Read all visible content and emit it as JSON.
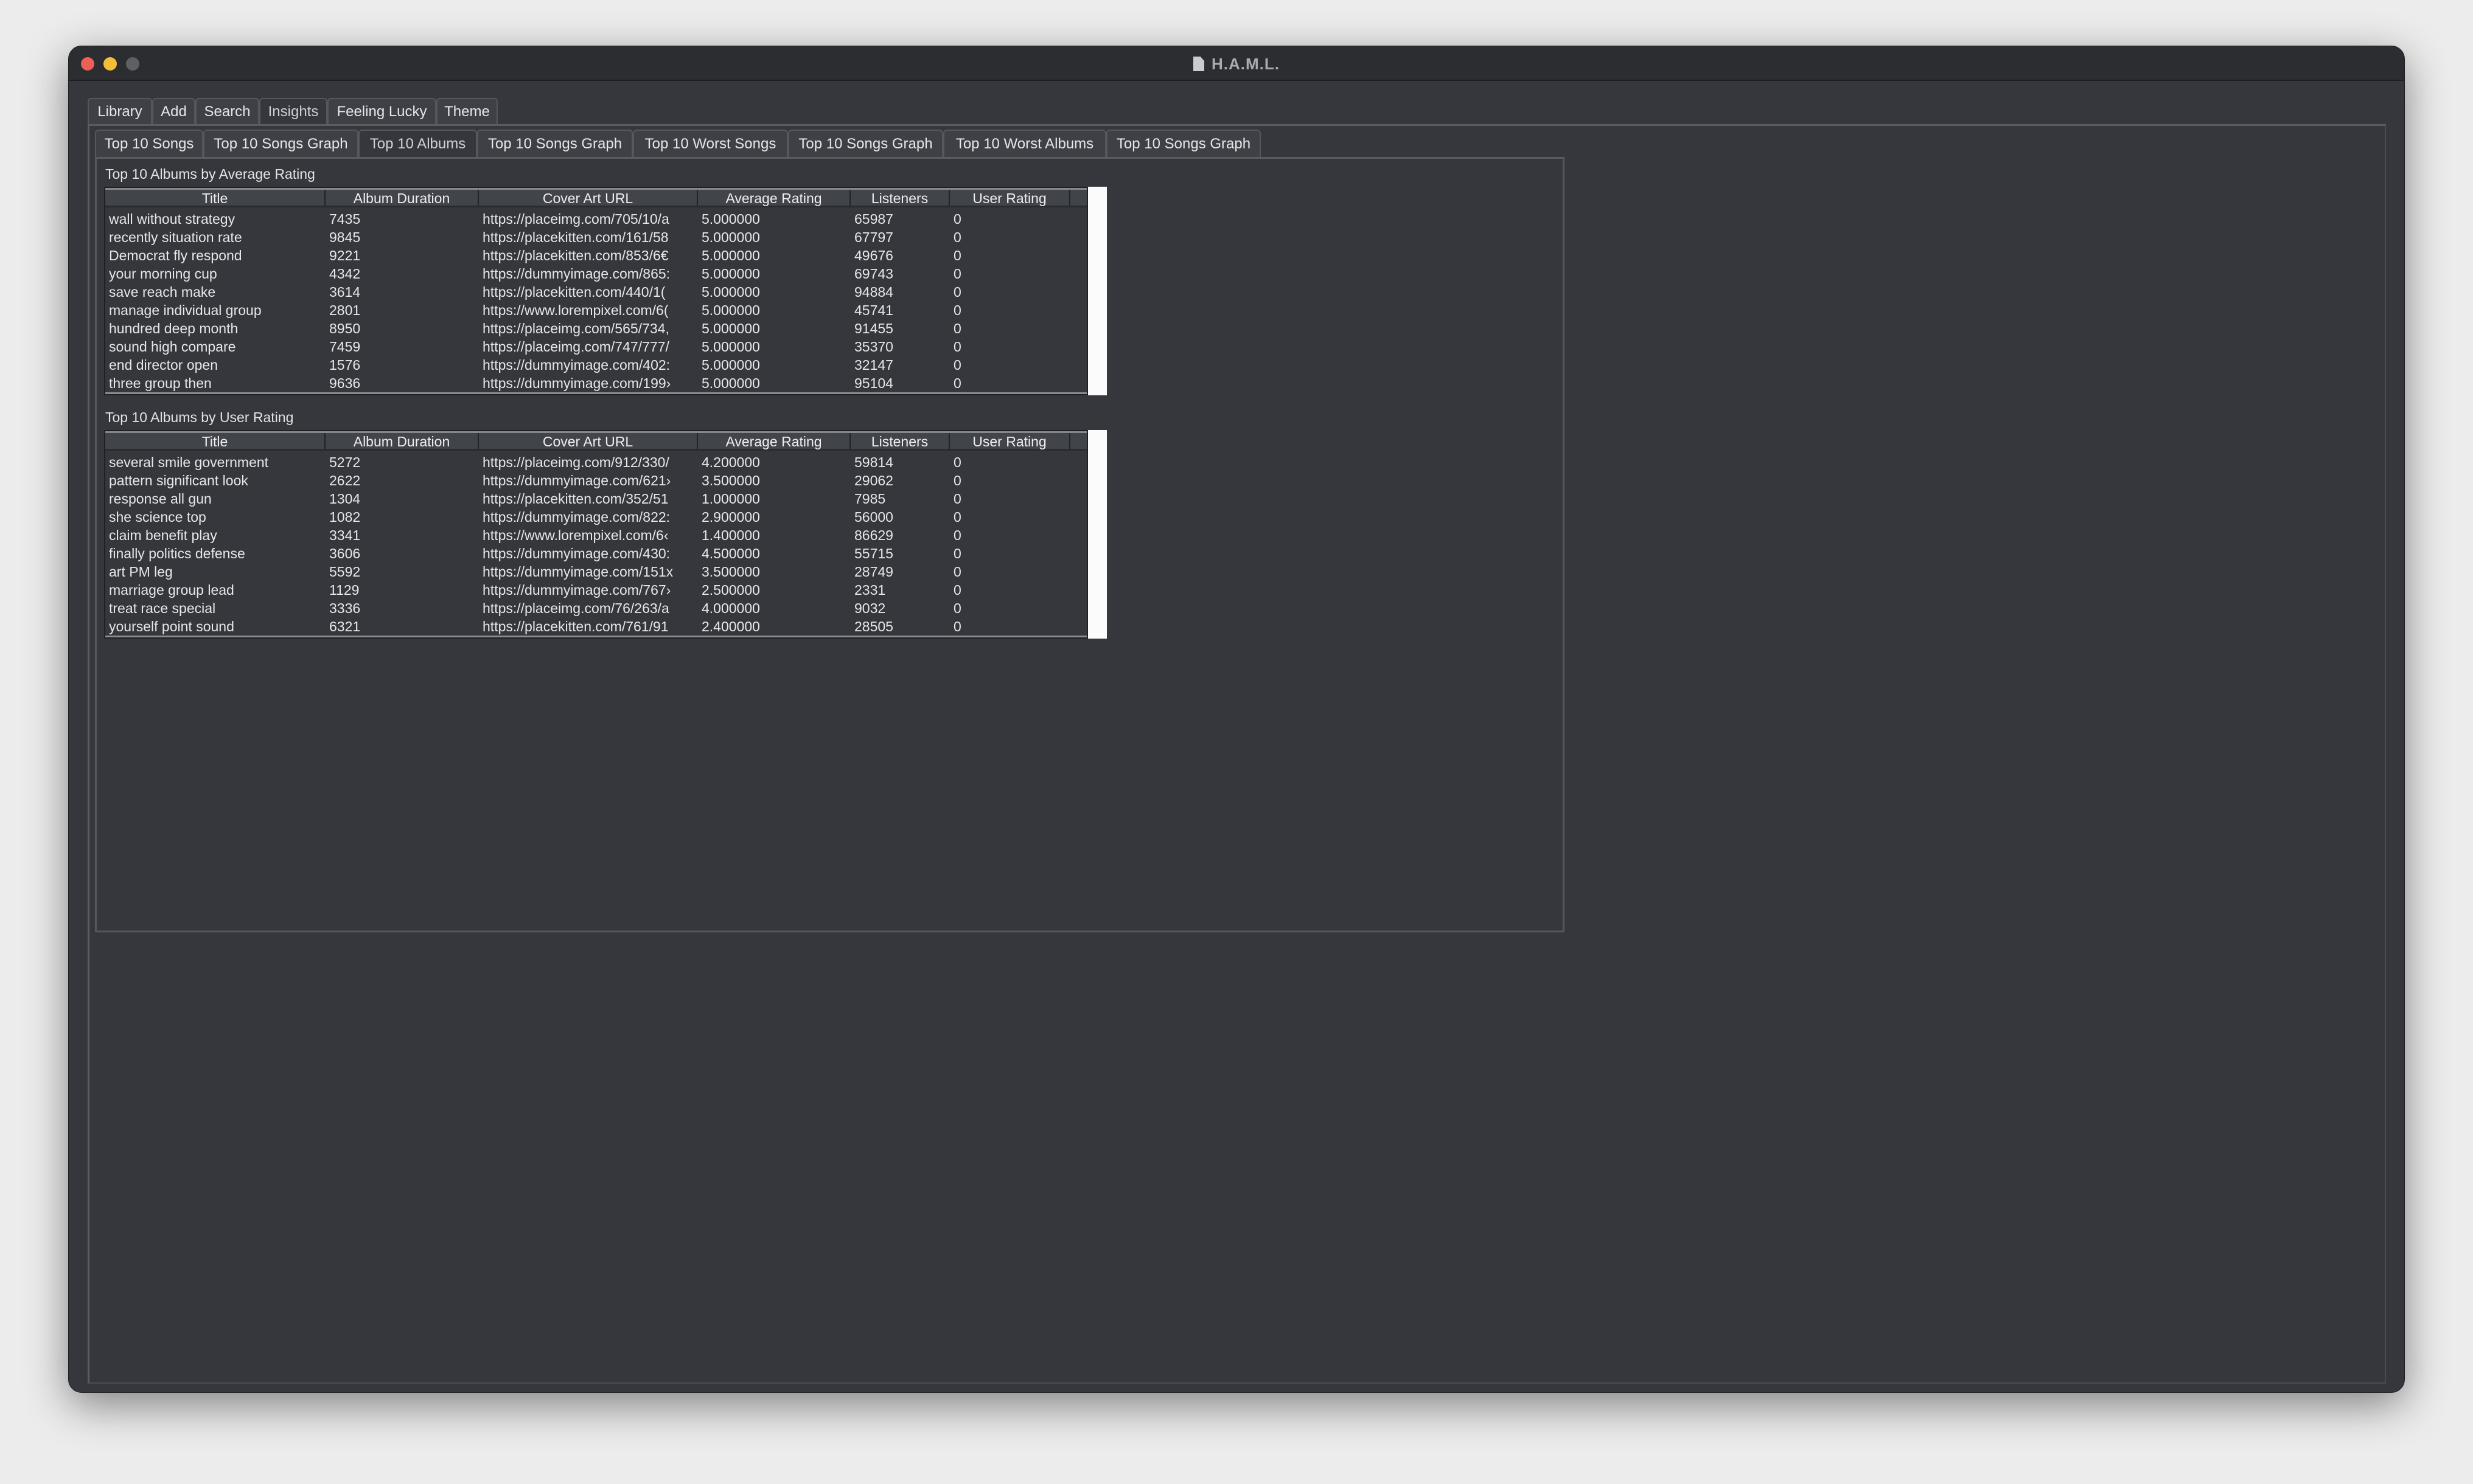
{
  "window": {
    "title": "H.A.M.L.",
    "lights": {
      "close": "#ee5f57",
      "minimize": "#f4bd3a",
      "zoom": "#5f6064"
    }
  },
  "main_tabs": [
    {
      "label": "Library"
    },
    {
      "label": "Add"
    },
    {
      "label": "Search"
    },
    {
      "label": "Insights",
      "selected": true
    },
    {
      "label": "Feeling Lucky"
    },
    {
      "label": "Theme"
    }
  ],
  "sub_tabs": [
    {
      "label": "Top 10 Songs"
    },
    {
      "label": "Top 10 Songs Graph"
    },
    {
      "label": "Top 10 Albums",
      "selected": true
    },
    {
      "label": "Top 10 Songs Graph"
    },
    {
      "label": "Top 10 Worst Songs"
    },
    {
      "label": "Top 10 Songs Graph"
    },
    {
      "label": "Top 10 Worst Albums"
    },
    {
      "label": "Top 10 Songs Graph"
    }
  ],
  "columns": [
    "Title",
    "Album Duration",
    "Cover Art URL",
    "Average Rating",
    "Listeners",
    "User Rating"
  ],
  "tables": [
    {
      "label": "Top 10 Albums by Average Rating",
      "rows": [
        [
          "wall without strategy",
          "7435",
          "https://placeimg.com/705/10/a",
          "5.000000",
          "65987",
          "0"
        ],
        [
          "recently situation rate",
          "9845",
          "https://placekitten.com/161/58",
          "5.000000",
          "67797",
          "0"
        ],
        [
          "Democrat fly respond",
          "9221",
          "https://placekitten.com/853/6€",
          "5.000000",
          "49676",
          "0"
        ],
        [
          "your morning cup",
          "4342",
          "https://dummyimage.com/865:",
          "5.000000",
          "69743",
          "0"
        ],
        [
          "save reach make",
          "3614",
          "https://placekitten.com/440/1(",
          "5.000000",
          "94884",
          "0"
        ],
        [
          "manage individual group",
          "2801",
          "https://www.lorempixel.com/6(",
          "5.000000",
          "45741",
          "0"
        ],
        [
          "hundred deep month",
          "8950",
          "https://placeimg.com/565/734,",
          "5.000000",
          "91455",
          "0"
        ],
        [
          "sound high compare",
          "7459",
          "https://placeimg.com/747/777/",
          "5.000000",
          "35370",
          "0"
        ],
        [
          "end director open",
          "1576",
          "https://dummyimage.com/402:",
          "5.000000",
          "32147",
          "0"
        ],
        [
          "three group then",
          "9636",
          "https://dummyimage.com/199›",
          "5.000000",
          "95104",
          "0"
        ]
      ]
    },
    {
      "label": "Top 10 Albums by User Rating",
      "rows": [
        [
          "several smile government",
          "5272",
          "https://placeimg.com/912/330/",
          "4.200000",
          "59814",
          "0"
        ],
        [
          "pattern significant look",
          "2622",
          "https://dummyimage.com/621›",
          "3.500000",
          "29062",
          "0"
        ],
        [
          "response all gun",
          "1304",
          "https://placekitten.com/352/51",
          "1.000000",
          "7985",
          "0"
        ],
        [
          "she science top",
          "1082",
          "https://dummyimage.com/822:",
          "2.900000",
          "56000",
          "0"
        ],
        [
          "claim benefit play",
          "3341",
          "https://www.lorempixel.com/6‹",
          "1.400000",
          "86629",
          "0"
        ],
        [
          "finally politics defense",
          "3606",
          "https://dummyimage.com/430:",
          "4.500000",
          "55715",
          "0"
        ],
        [
          "art PM leg",
          "5592",
          "https://dummyimage.com/151x",
          "3.500000",
          "28749",
          "0"
        ],
        [
          "marriage group lead",
          "1129",
          "https://dummyimage.com/767›",
          "2.500000",
          "2331",
          "0"
        ],
        [
          "treat race special",
          "3336",
          "https://placeimg.com/76/263/a",
          "4.000000",
          "9032",
          "0"
        ],
        [
          "yourself point sound",
          "6321",
          "https://placekitten.com/761/91",
          "2.400000",
          "28505",
          "0"
        ]
      ]
    }
  ]
}
